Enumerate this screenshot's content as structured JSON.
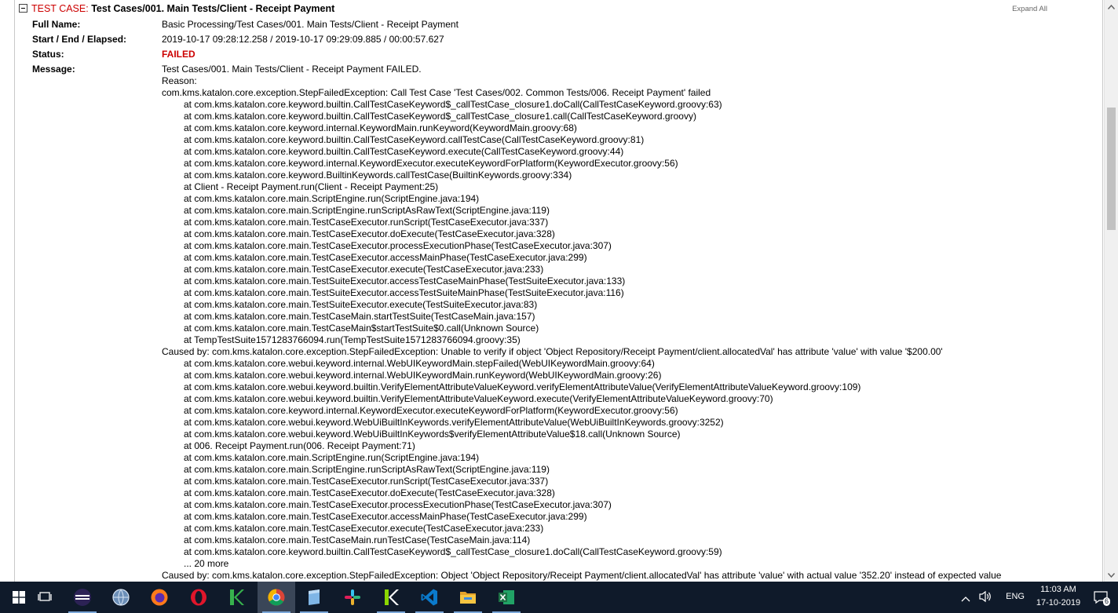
{
  "test_case": {
    "label": "TEST CASE:",
    "name": "Test Cases/001. Main Tests/Client - Receipt Payment",
    "expand_all": "Expand All"
  },
  "fields": {
    "full_name_label": "Full Name:",
    "full_name_value": "Basic Processing/Test Cases/001. Main Tests/Client - Receipt Payment",
    "timing_label": "Start / End / Elapsed:",
    "timing_value": "2019-10-17 09:28:12.258 / 2019-10-17 09:29:09.885 / 00:00:57.627",
    "status_label": "Status:",
    "status_value": "FAILED",
    "message_label": "Message:"
  },
  "message": [
    {
      "text": "Test Cases/001. Main Tests/Client - Receipt Payment FAILED.",
      "indent": false
    },
    {
      "text": "Reason:",
      "indent": false
    },
    {
      "text": "com.kms.katalon.core.exception.StepFailedException: Call Test Case 'Test Cases/002. Common Tests/006. Receipt Payment' failed",
      "indent": false
    },
    {
      "text": "at com.kms.katalon.core.keyword.builtin.CallTestCaseKeyword$_callTestCase_closure1.doCall(CallTestCaseKeyword.groovy:63)",
      "indent": true
    },
    {
      "text": "at com.kms.katalon.core.keyword.builtin.CallTestCaseKeyword$_callTestCase_closure1.call(CallTestCaseKeyword.groovy)",
      "indent": true
    },
    {
      "text": "at com.kms.katalon.core.keyword.internal.KeywordMain.runKeyword(KeywordMain.groovy:68)",
      "indent": true
    },
    {
      "text": "at com.kms.katalon.core.keyword.builtin.CallTestCaseKeyword.callTestCase(CallTestCaseKeyword.groovy:81)",
      "indent": true
    },
    {
      "text": "at com.kms.katalon.core.keyword.builtin.CallTestCaseKeyword.execute(CallTestCaseKeyword.groovy:44)",
      "indent": true
    },
    {
      "text": "at com.kms.katalon.core.keyword.internal.KeywordExecutor.executeKeywordForPlatform(KeywordExecutor.groovy:56)",
      "indent": true
    },
    {
      "text": "at com.kms.katalon.core.keyword.BuiltinKeywords.callTestCase(BuiltinKeywords.groovy:334)",
      "indent": true
    },
    {
      "text": "at Client - Receipt Payment.run(Client - Receipt Payment:25)",
      "indent": true
    },
    {
      "text": "at com.kms.katalon.core.main.ScriptEngine.run(ScriptEngine.java:194)",
      "indent": true
    },
    {
      "text": "at com.kms.katalon.core.main.ScriptEngine.runScriptAsRawText(ScriptEngine.java:119)",
      "indent": true
    },
    {
      "text": "at com.kms.katalon.core.main.TestCaseExecutor.runScript(TestCaseExecutor.java:337)",
      "indent": true
    },
    {
      "text": "at com.kms.katalon.core.main.TestCaseExecutor.doExecute(TestCaseExecutor.java:328)",
      "indent": true
    },
    {
      "text": "at com.kms.katalon.core.main.TestCaseExecutor.processExecutionPhase(TestCaseExecutor.java:307)",
      "indent": true
    },
    {
      "text": "at com.kms.katalon.core.main.TestCaseExecutor.accessMainPhase(TestCaseExecutor.java:299)",
      "indent": true
    },
    {
      "text": "at com.kms.katalon.core.main.TestCaseExecutor.execute(TestCaseExecutor.java:233)",
      "indent": true
    },
    {
      "text": "at com.kms.katalon.core.main.TestSuiteExecutor.accessTestCaseMainPhase(TestSuiteExecutor.java:133)",
      "indent": true
    },
    {
      "text": "at com.kms.katalon.core.main.TestSuiteExecutor.accessTestSuiteMainPhase(TestSuiteExecutor.java:116)",
      "indent": true
    },
    {
      "text": "at com.kms.katalon.core.main.TestSuiteExecutor.execute(TestSuiteExecutor.java:83)",
      "indent": true
    },
    {
      "text": "at com.kms.katalon.core.main.TestCaseMain.startTestSuite(TestCaseMain.java:157)",
      "indent": true
    },
    {
      "text": "at com.kms.katalon.core.main.TestCaseMain$startTestSuite$0.call(Unknown Source)",
      "indent": true
    },
    {
      "text": "at TempTestSuite1571283766094.run(TempTestSuite1571283766094.groovy:35)",
      "indent": true
    },
    {
      "text": "Caused by: com.kms.katalon.core.exception.StepFailedException: Unable to verify if object 'Object Repository/Receipt Payment/client.allocatedVal' has attribute 'value' with value '$200.00'",
      "indent": false
    },
    {
      "text": "at com.kms.katalon.core.webui.keyword.internal.WebUIKeywordMain.stepFailed(WebUIKeywordMain.groovy:64)",
      "indent": true
    },
    {
      "text": "at com.kms.katalon.core.webui.keyword.internal.WebUIKeywordMain.runKeyword(WebUIKeywordMain.groovy:26)",
      "indent": true
    },
    {
      "text": "at com.kms.katalon.core.webui.keyword.builtin.VerifyElementAttributeValueKeyword.verifyElementAttributeValue(VerifyElementAttributeValueKeyword.groovy:109)",
      "indent": true
    },
    {
      "text": "at com.kms.katalon.core.webui.keyword.builtin.VerifyElementAttributeValueKeyword.execute(VerifyElementAttributeValueKeyword.groovy:70)",
      "indent": true
    },
    {
      "text": "at com.kms.katalon.core.keyword.internal.KeywordExecutor.executeKeywordForPlatform(KeywordExecutor.groovy:56)",
      "indent": true
    },
    {
      "text": "at com.kms.katalon.core.webui.keyword.WebUiBuiltInKeywords.verifyElementAttributeValue(WebUiBuiltInKeywords.groovy:3252)",
      "indent": true
    },
    {
      "text": "at com.kms.katalon.core.webui.keyword.WebUiBuiltInKeywords$verifyElementAttributeValue$18.call(Unknown Source)",
      "indent": true
    },
    {
      "text": "at 006. Receipt Payment.run(006. Receipt Payment:71)",
      "indent": true
    },
    {
      "text": "at com.kms.katalon.core.main.ScriptEngine.run(ScriptEngine.java:194)",
      "indent": true
    },
    {
      "text": "at com.kms.katalon.core.main.ScriptEngine.runScriptAsRawText(ScriptEngine.java:119)",
      "indent": true
    },
    {
      "text": "at com.kms.katalon.core.main.TestCaseExecutor.runScript(TestCaseExecutor.java:337)",
      "indent": true
    },
    {
      "text": "at com.kms.katalon.core.main.TestCaseExecutor.doExecute(TestCaseExecutor.java:328)",
      "indent": true
    },
    {
      "text": "at com.kms.katalon.core.main.TestCaseExecutor.processExecutionPhase(TestCaseExecutor.java:307)",
      "indent": true
    },
    {
      "text": "at com.kms.katalon.core.main.TestCaseExecutor.accessMainPhase(TestCaseExecutor.java:299)",
      "indent": true
    },
    {
      "text": "at com.kms.katalon.core.main.TestCaseExecutor.execute(TestCaseExecutor.java:233)",
      "indent": true
    },
    {
      "text": "at com.kms.katalon.core.main.TestCaseMain.runTestCase(TestCaseMain.java:114)",
      "indent": true
    },
    {
      "text": "at com.kms.katalon.core.keyword.builtin.CallTestCaseKeyword$_callTestCase_closure1.doCall(CallTestCaseKeyword.groovy:59)",
      "indent": true
    },
    {
      "text": "... 20 more",
      "indent": true
    },
    {
      "text": "Caused by: com.kms.katalon.core.exception.StepFailedException: Object 'Object Repository/Receipt Payment/client.allocatedVal' has attribute 'value' with actual value '352.20' instead of expected value",
      "indent": false
    }
  ],
  "taskbar": {
    "apps": [
      {
        "icon": "windows-start-icon",
        "color": "#ffffff"
      },
      {
        "icon": "task-view-icon",
        "color": "#ffffff"
      },
      {
        "icon": "eclipse-icon",
        "color": "#2c2255"
      },
      {
        "icon": "globe-app-icon",
        "color": "#6c8fb8"
      },
      {
        "icon": "firefox-icon",
        "color": "#ff7a1a"
      },
      {
        "icon": "opera-icon",
        "color": "#e0162b"
      },
      {
        "icon": "katalon-icon",
        "color": "#37b24d"
      },
      {
        "icon": "chrome-icon",
        "color": "#4285f4"
      },
      {
        "icon": "notepad-app-icon",
        "color": "#7fb5e6"
      },
      {
        "icon": "slack-icon",
        "color": "#e01e5a"
      },
      {
        "icon": "katalon-studio-icon",
        "color": "#8bd600"
      },
      {
        "icon": "vscode-icon",
        "color": "#0a7acc"
      },
      {
        "icon": "file-explorer-icon",
        "color": "#f5c542"
      },
      {
        "icon": "excel-icon",
        "color": "#1e7145"
      }
    ],
    "language": "ENG",
    "time": "11:03 AM",
    "date": "17-10-2019",
    "notification_count": "6"
  }
}
